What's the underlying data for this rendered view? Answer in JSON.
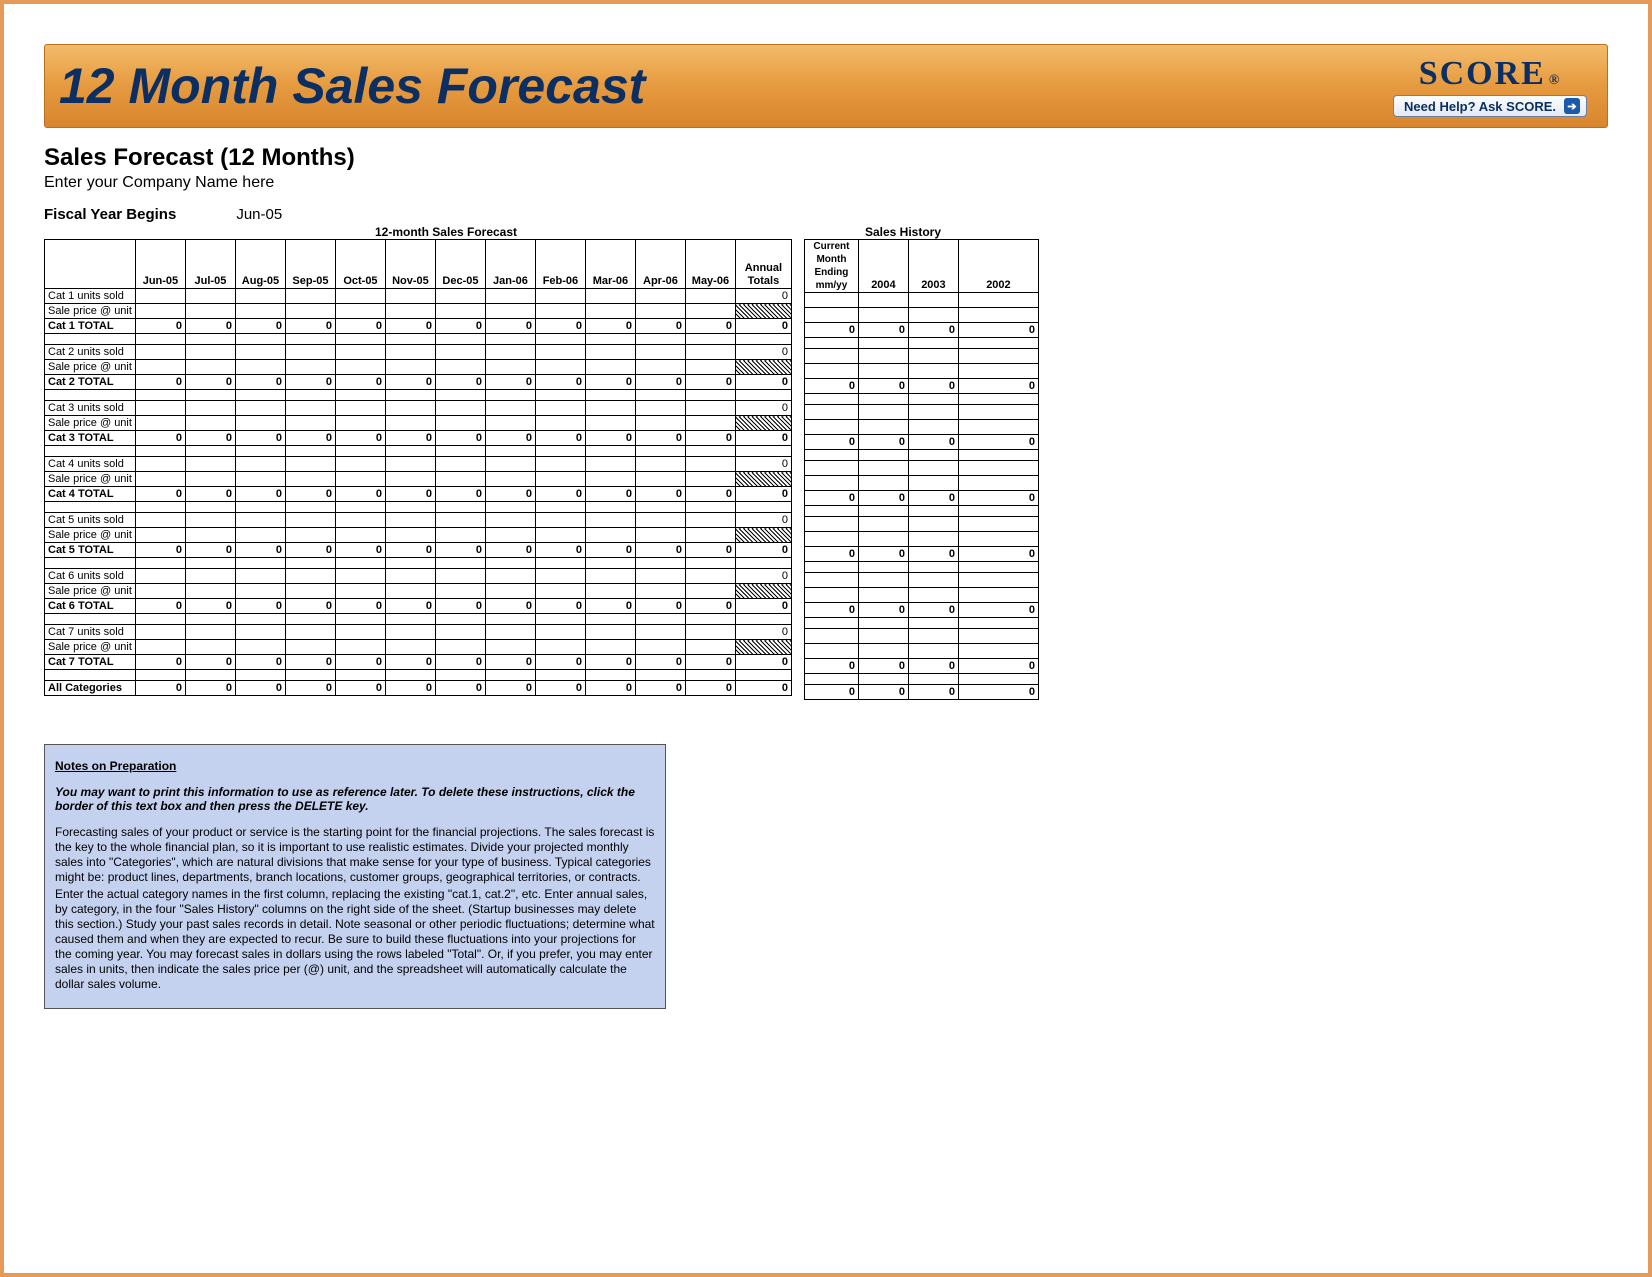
{
  "banner": {
    "title": "12 Month Sales Forecast",
    "logo_text": "SCORE",
    "logo_reg": "®",
    "help_button": "Need Help? Ask SCORE."
  },
  "header": {
    "title": "Sales Forecast (12 Months)",
    "company_placeholder": "Enter your Company Name here",
    "fy_label": "Fiscal Year Begins",
    "fy_value": "Jun-05",
    "forecast_header": "12-month Sales Forecast",
    "history_header": "Sales History"
  },
  "columns": {
    "months": [
      "Jun-05",
      "Jul-05",
      "Aug-05",
      "Sep-05",
      "Oct-05",
      "Nov-05",
      "Dec-05",
      "Jan-06",
      "Feb-06",
      "Mar-06",
      "Apr-06",
      "May-06"
    ],
    "annual_totals": "Annual Totals",
    "cme": "Current Month Ending mm/yy",
    "history_years": [
      "2004",
      "2003",
      "2002"
    ]
  },
  "rows": {
    "blocks": [
      {
        "units": "Cat 1 units sold",
        "price": "Sale price @ unit",
        "total": "Cat 1 TOTAL"
      },
      {
        "units": "Cat 2 units sold",
        "price": "Sale price @ unit",
        "total": "Cat 2 TOTAL"
      },
      {
        "units": "Cat 3 units sold",
        "price": "Sale price @ unit",
        "total": "Cat 3 TOTAL"
      },
      {
        "units": "Cat 4 units sold",
        "price": "Sale price @ unit",
        "total": "Cat 4 TOTAL"
      },
      {
        "units": "Cat 5 units sold",
        "price": "Sale price @ unit",
        "total": "Cat 5 TOTAL"
      },
      {
        "units": "Cat 6 units sold",
        "price": "Sale price @ unit",
        "total": "Cat 6 TOTAL"
      },
      {
        "units": "Cat 7 units sold",
        "price": "Sale price @ unit",
        "total": "Cat 7 TOTAL"
      }
    ],
    "all_cat": "All Categories",
    "zero": "0"
  },
  "notes": {
    "title": "Notes on Preparation",
    "warn": "You may want to print this information to use as reference later. To delete these instructions, click the border of this text box and then press the DELETE key.",
    "p1": "Forecasting sales of your product or service is the starting point for the financial projections. The sales forecast is the key to the whole financial plan, so it is important to use realistic estimates. Divide your projected monthly sales into \"Categories\", which are natural divisions that make sense for your type of business. Typical categories might be: product lines, departments, branch locations, customer groups, geographical territories, or contracts.",
    "p2": "Enter the actual category names in the first column, replacing the existing \"cat.1, cat.2\", etc. Enter annual sales, by category, in the four \"Sales History\" columns on the right side of the sheet. (Startup businesses may delete this section.) Study your past sales records in detail. Note seasonal or other periodic fluctuations; determine what caused them and when they are expected to recur. Be sure to build these fluctuations into your projections for the coming year. You may forecast sales in dollars using the rows labeled \"Total\".  Or, if you prefer, you may enter sales in units, then indicate the sales price per (@) unit, and the spreadsheet will automatically calculate the dollar sales volume."
  }
}
